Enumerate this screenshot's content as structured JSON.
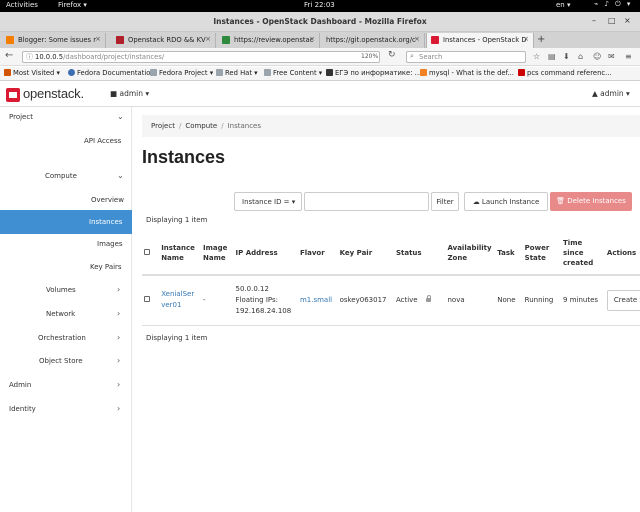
{
  "gnome": {
    "activities": "Activities",
    "app": "Firefox ▾",
    "clock": "Fri 22:03",
    "lang": "en ▾",
    "icons": "⌁ ♪ ⏻ ▾"
  },
  "window": {
    "title": "Instances - OpenStack Dashboard - Mozilla Firefox",
    "minimize": "–",
    "maximize": "□",
    "close": "×"
  },
  "tabs": [
    {
      "label": "Blogger: Some issues r",
      "color": "#f57d00"
    },
    {
      "label": "Openstack RDO && KV",
      "color": "#b0202a"
    },
    {
      "label": "https://review.openstac",
      "color": "#2e8b3d"
    },
    {
      "label": "https://git.openstack.org/c",
      "color": "#cccccc"
    },
    {
      "label": "Instances - OpenStack D",
      "color": "#da1a32"
    }
  ],
  "tab_close": "×",
  "new_tab": "+",
  "navbar": {
    "back": "←",
    "info": "ⓘ",
    "url_host": "10.0.0.5",
    "url_path": "/dashboard/project/instances/",
    "zoom": "120%",
    "reload": "↻",
    "search_placeholder": "Search",
    "search_icon": "⌕",
    "toolbar_icons": [
      "☆",
      "▤",
      "⬇",
      "⌂",
      "☺",
      "✉",
      "≡"
    ]
  },
  "bookmarks": [
    {
      "label": "Most Visited ▾",
      "color": "#d35400"
    },
    {
      "label": "Fedora Documentation",
      "color": "#3c6eb4"
    },
    {
      "label": "Fedora Project ▾",
      "color": "#3c6eb4"
    },
    {
      "label": "Red Hat ▾",
      "color": "#999999"
    },
    {
      "label": "Free Content ▾",
      "color": "#999999"
    },
    {
      "label": "ЕГЭ по информатике: ...",
      "color": "#333333"
    },
    {
      "label": "mysql - What is the def...",
      "color": "#f48024"
    },
    {
      "label": "pcs command referenc...",
      "color": "#cc0000"
    }
  ],
  "header": {
    "logo_text": "openstack.",
    "project_menu": "■ admin ▾",
    "user_menu": "▲ admin ▾"
  },
  "sidebar": {
    "project": "Project",
    "api_access": "API Access",
    "compute": "Compute",
    "overview": "Overview",
    "instances": "Instances",
    "images": "Images",
    "key_pairs": "Key Pairs",
    "volumes": "Volumes",
    "network": "Network",
    "orchestration": "Orchestration",
    "object_store": "Object Store",
    "admin": "Admin",
    "identity": "Identity",
    "chevron_open": "⌄",
    "chevron_closed": "›"
  },
  "breadcrumb": {
    "project": "Project",
    "compute": "Compute",
    "current": "Instances",
    "sep": "/"
  },
  "page_title": "Instances",
  "toolbar": {
    "filter_select": "Instance ID = ▾",
    "filter_value": "",
    "filter_button": "Filter",
    "launch_button": "☁ Launch Instance",
    "delete_button": "🗑 Delete Instances"
  },
  "accent": "#3f8fd2",
  "danger": "#e98a8a",
  "displaying": "Displaying 1 item",
  "table": {
    "headers": [
      "Instance Name",
      "Image Name",
      "IP Address",
      "Flavor",
      "Key Pair",
      "Status",
      "Availability Zone",
      "Task",
      "Power State",
      "Time since created",
      "Actions"
    ],
    "rows": [
      {
        "instance_name": "XenialServer01",
        "image_name": "-",
        "ip1": "50.0.0.12",
        "ip2": "Floating IPs:",
        "ip3": "192.168.24.108",
        "flavor": "m1.small",
        "key_pair": "oskey063017",
        "status": "Active",
        "az": "nova",
        "task": "None",
        "power_state": "Running",
        "age": "9 minutes",
        "action": "Create Snapshot"
      }
    ]
  }
}
